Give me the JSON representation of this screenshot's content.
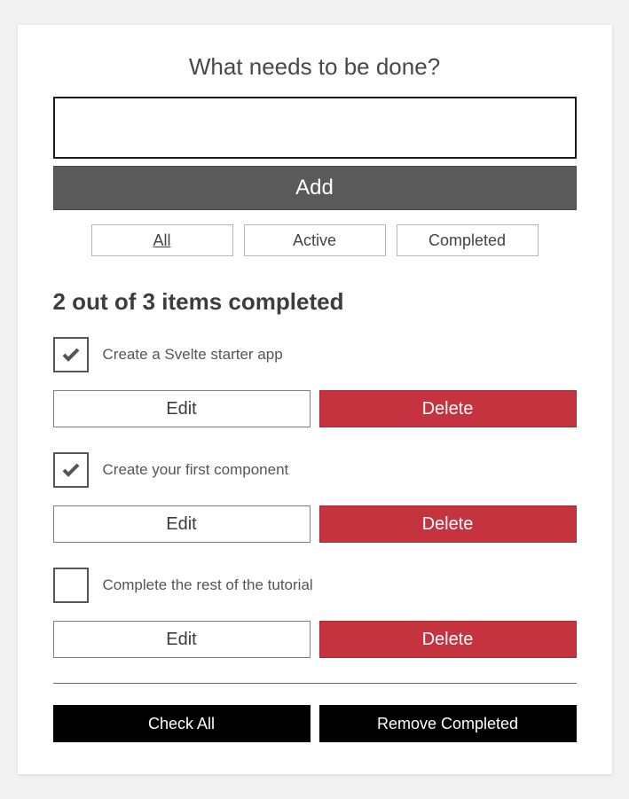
{
  "header": {
    "title": "What needs to be done?"
  },
  "form": {
    "input_value": "",
    "add_label": "Add"
  },
  "filters": {
    "all": "All",
    "active": "Active",
    "completed": "Completed",
    "selected": "All"
  },
  "status": {
    "completed": 2,
    "total": 3,
    "text": "2 out of 3 items completed"
  },
  "buttons": {
    "edit": "Edit",
    "delete": "Delete",
    "check_all": "Check All",
    "remove_completed": "Remove Completed"
  },
  "items": [
    {
      "label": "Create a Svelte starter app",
      "completed": true
    },
    {
      "label": "Create your first component",
      "completed": true
    },
    {
      "label": "Complete the rest of the tutorial",
      "completed": false
    }
  ]
}
